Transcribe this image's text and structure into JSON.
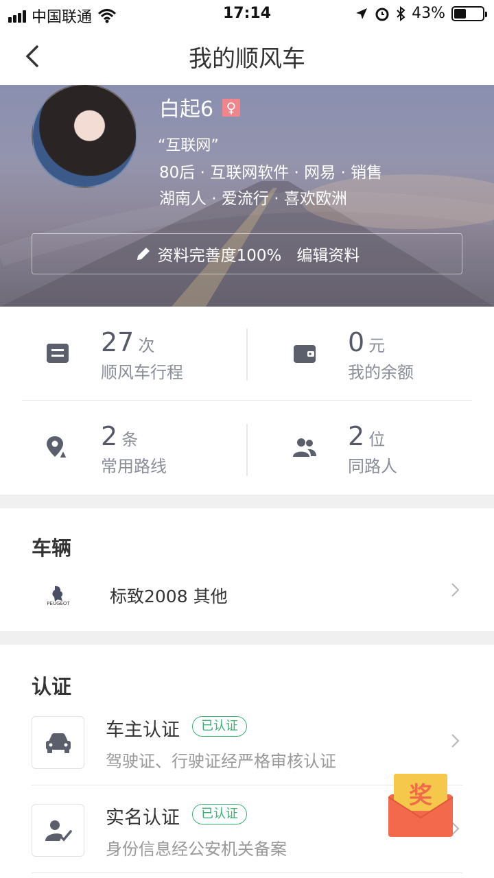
{
  "status_bar": {
    "carrier": "中国联通",
    "time": "17:14",
    "battery_percent": "43%",
    "battery_level": 0.43
  },
  "nav": {
    "title": "我的顺风车"
  },
  "profile": {
    "name": "白起6",
    "gender_symbol": "♀",
    "tag": "“互联网”",
    "line1": "80后 · 互联网软件 · 网易 · 销售",
    "line2": "湖南人 · 爱流行 · 喜欢欧洲",
    "completeness": "资料完善度100%",
    "edit_label": "编辑资料"
  },
  "stats": [
    {
      "value": "27",
      "unit": "次",
      "label": "顺风车行程",
      "icon": "trip-icon"
    },
    {
      "value": "0",
      "unit": "元",
      "label": "我的余额",
      "icon": "wallet-icon"
    },
    {
      "value": "2",
      "unit": "条",
      "label": "常用路线",
      "icon": "route-icon"
    },
    {
      "value": "2",
      "unit": "位",
      "label": "同路人",
      "icon": "people-icon"
    }
  ],
  "vehicle": {
    "section_title": "车辆",
    "brand_logo_text": "PEUGEOT",
    "name": "标致2008 其他"
  },
  "certification": {
    "section_title": "认证",
    "items": [
      {
        "title": "车主认证",
        "badge": "已认证",
        "desc": "驾驶证、行驶证经严格审核认证",
        "icon": "car-icon"
      },
      {
        "title": "实名认证",
        "badge": "已认证",
        "desc": "身份信息经公安机关备案",
        "icon": "verified-user-icon"
      }
    ]
  },
  "reward": {
    "label": "奖"
  },
  "colors": {
    "accent_green": "#37b271",
    "gender_pink": "#f0868b",
    "reward_orange": "#f26a4b",
    "reward_yellow": "#f5c84b"
  }
}
